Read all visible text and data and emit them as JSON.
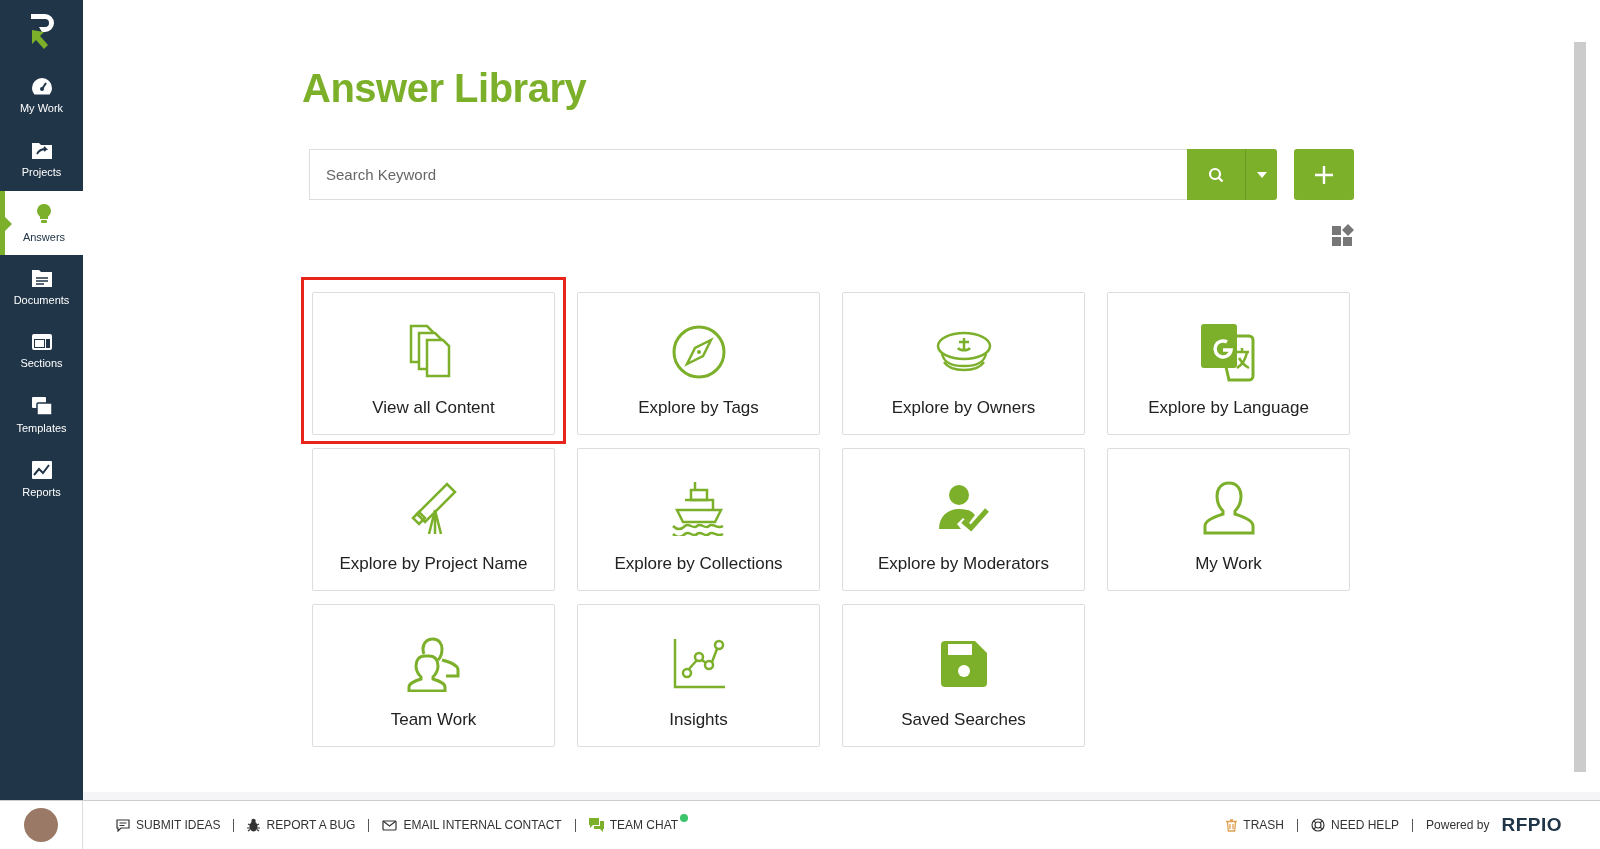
{
  "sidebar": {
    "items": [
      {
        "label": "My Work",
        "selected": false
      },
      {
        "label": "Projects",
        "selected": false
      },
      {
        "label": "Answers",
        "selected": true
      },
      {
        "label": "Documents",
        "selected": false
      },
      {
        "label": "Sections",
        "selected": false
      },
      {
        "label": "Templates",
        "selected": false
      },
      {
        "label": "Reports",
        "selected": false
      }
    ]
  },
  "page": {
    "title": "Answer Library"
  },
  "search": {
    "placeholder": "Search Keyword"
  },
  "cards": [
    {
      "label": "View all Content",
      "highlighted": true
    },
    {
      "label": "Explore by Tags",
      "highlighted": false
    },
    {
      "label": "Explore by Owners",
      "highlighted": false
    },
    {
      "label": "Explore by Language",
      "highlighted": false
    },
    {
      "label": "Explore by Project Name",
      "highlighted": false
    },
    {
      "label": "Explore by Collections",
      "highlighted": false
    },
    {
      "label": "Explore by Moderators",
      "highlighted": false
    },
    {
      "label": "My Work",
      "highlighted": false
    },
    {
      "label": "Team Work",
      "highlighted": false
    },
    {
      "label": "Insights",
      "highlighted": false
    },
    {
      "label": "Saved Searches",
      "highlighted": false
    }
  ],
  "footer": {
    "links": [
      {
        "label": "SUBMIT IDEAS"
      },
      {
        "label": "REPORT A BUG"
      },
      {
        "label": "EMAIL INTERNAL CONTACT"
      },
      {
        "label": "TEAM CHAT",
        "online": true
      }
    ],
    "right_links": [
      {
        "label": "TRASH"
      },
      {
        "label": "NEED HELP"
      }
    ],
    "powered_by": "Powered by",
    "brand": "RFPIO"
  }
}
